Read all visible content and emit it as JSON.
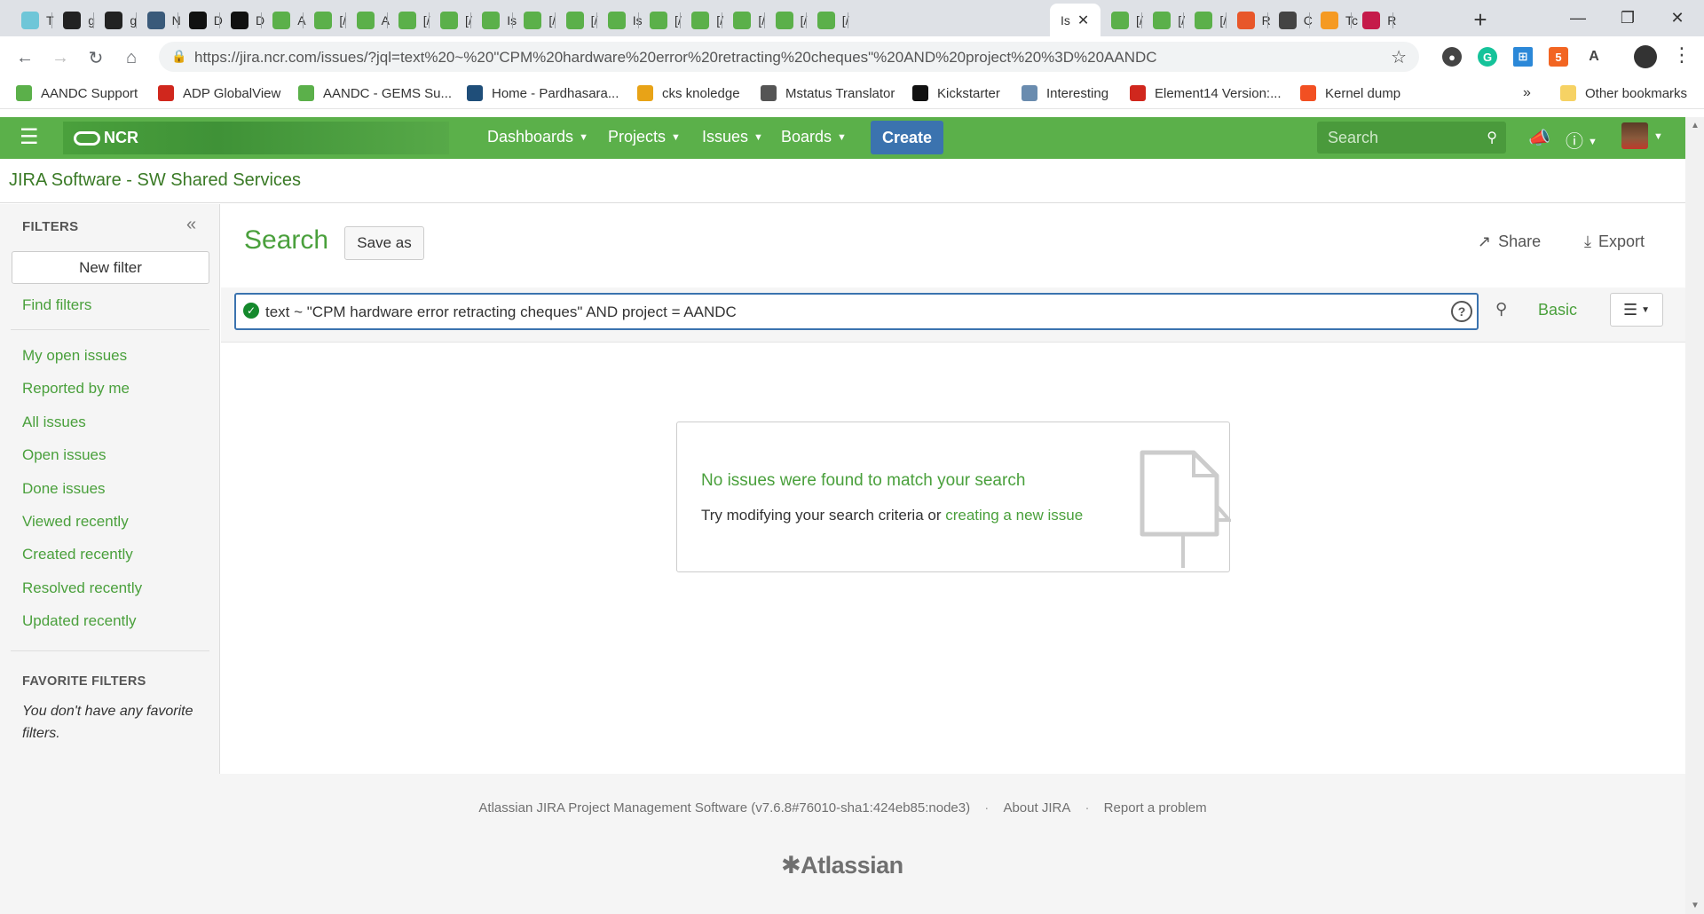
{
  "browser": {
    "tabs": [
      {
        "label": "T",
        "icon": "cloud-icon",
        "color": "#6fc6d8"
      },
      {
        "label": "g",
        "icon": "github-icon",
        "color": "#222222"
      },
      {
        "label": "g",
        "icon": "github-icon",
        "color": "#222222"
      },
      {
        "label": "N",
        "icon": "doc-icon",
        "color": "#3a5a7a"
      },
      {
        "label": "D",
        "icon": "medium-icon",
        "color": "#111111"
      },
      {
        "label": "D",
        "icon": "medium-icon",
        "color": "#111111"
      },
      {
        "label": "A",
        "icon": "ncr-icon",
        "color": "#5bb04a"
      },
      {
        "label": "[/",
        "icon": "ncr-icon",
        "color": "#5bb04a"
      },
      {
        "label": "A",
        "icon": "ncr-icon",
        "color": "#5bb04a"
      },
      {
        "label": "[/",
        "icon": "ncr-icon",
        "color": "#5bb04a"
      },
      {
        "label": "[/",
        "icon": "ncr-icon",
        "color": "#5bb04a"
      },
      {
        "label": "Is",
        "icon": "ncr-icon",
        "color": "#5bb04a"
      },
      {
        "label": "[/",
        "icon": "ncr-icon",
        "color": "#5bb04a"
      },
      {
        "label": "[/",
        "icon": "ncr-icon",
        "color": "#5bb04a"
      },
      {
        "label": "Is",
        "icon": "ncr-icon",
        "color": "#5bb04a"
      },
      {
        "label": "[/",
        "icon": "ncr-icon",
        "color": "#5bb04a"
      },
      {
        "label": "[/",
        "icon": "ncr-icon",
        "color": "#5bb04a"
      },
      {
        "label": "[/",
        "icon": "ncr-icon",
        "color": "#5bb04a"
      },
      {
        "label": "[/",
        "icon": "ncr-icon",
        "color": "#5bb04a"
      },
      {
        "label": "[/",
        "icon": "ncr-icon",
        "color": "#5bb04a"
      }
    ],
    "active_tab": {
      "label": "Is",
      "close": "✕"
    },
    "tabs_after": [
      {
        "label": "[/",
        "icon": "ncr-icon",
        "color": "#5bb04a"
      },
      {
        "label": "[/",
        "icon": "ncr-icon",
        "color": "#5bb04a"
      },
      {
        "label": "[/",
        "icon": "ncr-icon",
        "color": "#5bb04a"
      },
      {
        "label": "R",
        "icon": "matlab-icon",
        "color": "#e8572a"
      },
      {
        "label": "C",
        "icon": "robot-icon",
        "color": "#444444"
      },
      {
        "label": "Tc",
        "icon": "tensorflow-icon",
        "color": "#f59a23"
      },
      {
        "label": "R",
        "icon": "raspberry-icon",
        "color": "#c51a4a"
      }
    ],
    "url": "https://jira.ncr.com/issues/?jql=text%20~%20\"CPM%20hardware%20error%20retracting%20cheques\"%20AND%20project%20%3D%20AANDC",
    "bookmarks": [
      {
        "label": "AANDC Support",
        "icon": "ncr-icon",
        "color": "#5bb04a"
      },
      {
        "label": "ADP GlobalView",
        "icon": "adp-icon",
        "color": "#d0271d"
      },
      {
        "label": "AANDC - GEMS Su...",
        "icon": "ncr-icon",
        "color": "#5bb04a"
      },
      {
        "label": "Home - Pardhasara...",
        "icon": "sharepoint-icon",
        "color": "#1f4e79"
      },
      {
        "label": "cks knoledge",
        "icon": "globe-icon",
        "color": "#e8a317"
      },
      {
        "label": "Mstatus Translator",
        "icon": "globe-icon",
        "color": "#555555"
      },
      {
        "label": "Kickstarter",
        "icon": "kickstarter-icon",
        "color": "#111111"
      },
      {
        "label": "Interesting",
        "icon": "owl-icon",
        "color": "#6a8caf"
      },
      {
        "label": "Element14 Version:...",
        "icon": "element14-icon",
        "color": "#d0271d"
      },
      {
        "label": "Kernel dump",
        "icon": "windows-icon",
        "color": "#f25022"
      }
    ],
    "bookmarks_overflow": "»",
    "other_bookmarks": "Other bookmarks"
  },
  "jira": {
    "logo_text": "NCR",
    "nav": [
      {
        "label": "Dashboards"
      },
      {
        "label": "Projects"
      },
      {
        "label": "Issues"
      },
      {
        "label": "Boards"
      }
    ],
    "create_label": "Create",
    "search_placeholder": "Search",
    "project_title": "JIRA Software - SW Shared Services",
    "colors": {
      "header": "#5bb04a",
      "link": "#4aa03c",
      "create": "#3b73af"
    }
  },
  "sidebar": {
    "heading": "FILTERS",
    "new_filter": "New filter",
    "find_filters": "Find filters",
    "filters": [
      "My open issues",
      "Reported by me",
      "All issues",
      "Open issues",
      "Done issues",
      "Viewed recently",
      "Created recently",
      "Resolved recently",
      "Updated recently"
    ],
    "favorite_heading": "FAVORITE FILTERS",
    "favorite_note": "You don't have any favorite filters."
  },
  "main": {
    "title": "Search",
    "save_as": "Save as",
    "share": "Share",
    "export": "Export",
    "jql_query": "text ~ \"CPM hardware error retracting cheques\" AND project = AANDC",
    "basic_label": "Basic",
    "empty_title": "No issues were found to match your search",
    "empty_msg": "Try modifying your search criteria or ",
    "empty_link": "creating a new issue"
  },
  "footer": {
    "version": "Atlassian JIRA Project Management Software (v7.6.8#76010-sha1:424eb85:node3)",
    "about": "About JIRA",
    "report": "Report a problem",
    "brand": "Atlassian"
  }
}
